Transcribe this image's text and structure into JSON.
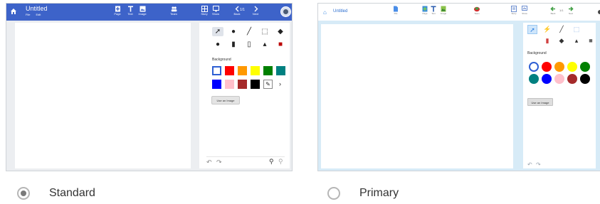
{
  "options": [
    {
      "id": "standard",
      "label": "Standard",
      "selected": true,
      "app": {
        "title": "Untitled",
        "menus": [
          "File",
          "Edit"
        ],
        "toolbar": [
          {
            "icon": "page-icon",
            "label": "Page"
          },
          {
            "icon": "text-icon",
            "label": "Text"
          },
          {
            "icon": "image-icon",
            "label": "Image"
          },
          {
            "icon": "team-icon",
            "label": "Team"
          },
          {
            "icon": "story-icon",
            "label": "Story"
          },
          {
            "icon": "show-icon",
            "label": "Show"
          },
          {
            "icon": "back-icon",
            "label": "Back"
          },
          {
            "icon": "next-icon",
            "label": "Next"
          }
        ],
        "page_indicator": "1/1",
        "background_label": "Background",
        "use_image_label": "Use an Image",
        "tools": [
          "select-icon",
          "mic-icon",
          "pen-icon",
          "crop-icon",
          "eraser-icon",
          "shapes-icon",
          "bottle-icon",
          "jar-icon",
          "hand-icon",
          "delete-icon"
        ],
        "swatches": [
          "#ffffff",
          "#ff0000",
          "#ff9900",
          "#ffff00",
          "#008000",
          "#008080",
          "#0000ff",
          "#ffc0cb",
          "#a52a2a",
          "#000000"
        ],
        "accent": "#3d63c9"
      }
    },
    {
      "id": "primary",
      "label": "Primary",
      "selected": false,
      "app": {
        "title": "Untitled",
        "toolbar": [
          {
            "icon": "file-icon",
            "label": "File"
          },
          {
            "icon": "page-icon",
            "label": "Page"
          },
          {
            "icon": "text-icon",
            "label": "Text"
          },
          {
            "icon": "image-icon",
            "label": "Image"
          },
          {
            "icon": "team-icon",
            "label": "Team"
          },
          {
            "icon": "story-icon",
            "label": "Story"
          },
          {
            "icon": "show-icon",
            "label": "Show"
          },
          {
            "icon": "back-icon",
            "label": "Back"
          },
          {
            "icon": "next-icon",
            "label": "Next"
          }
        ],
        "page_indicator": "1/1",
        "background_label": "Background",
        "use_image_label": "Use an Image",
        "swatches": [
          "#ffffff",
          "#ff0000",
          "#ff9900",
          "#ffff00",
          "#008000",
          "#008080",
          "#0000ff",
          "#ffc0cb",
          "#a52a2a",
          "#000000"
        ],
        "accent": "#2d7fe0"
      }
    }
  ]
}
